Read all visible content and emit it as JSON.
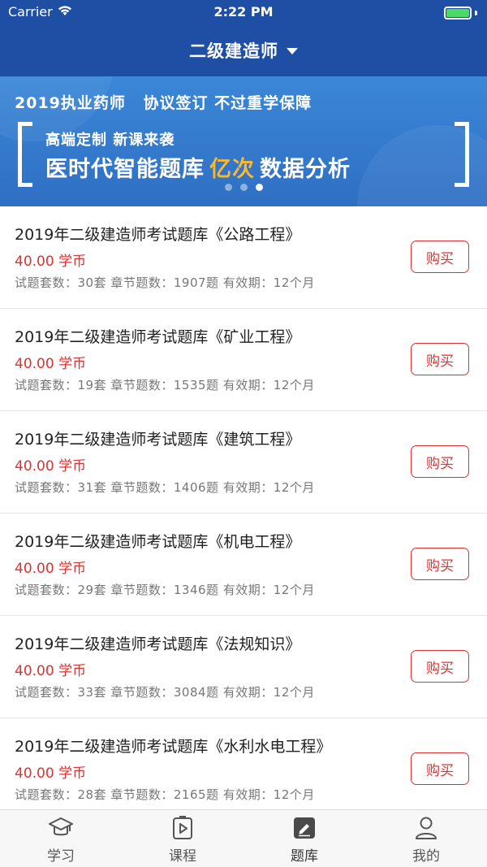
{
  "status_bar": {
    "carrier": "Carrier",
    "time": "2:22 PM"
  },
  "header": {
    "title": "二级建造师"
  },
  "banner": {
    "line1_a": "2019执业药师",
    "line1_b": "协议签订 不过重学保障",
    "line2": "高端定制 新课来袭",
    "line3_a": "医时代智能题库",
    "line3_highlight": "亿次",
    "line3_b": "数据分析",
    "dots_count": 3,
    "active_dot": 2
  },
  "products": [
    {
      "title": "2019年二级建造师考试题库《公路工程》",
      "price": "40.00 学币",
      "meta": "试题套数：30套   章节题数：1907题   有效期：12个月",
      "buy_label": "购买"
    },
    {
      "title": "2019年二级建造师考试题库《矿业工程》",
      "price": "40.00 学币",
      "meta": "试题套数：19套   章节题数：1535题   有效期：12个月",
      "buy_label": "购买"
    },
    {
      "title": "2019年二级建造师考试题库《建筑工程》",
      "price": "40.00 学币",
      "meta": "试题套数：31套   章节题数：1406题   有效期：12个月",
      "buy_label": "购买"
    },
    {
      "title": "2019年二级建造师考试题库《机电工程》",
      "price": "40.00 学币",
      "meta": "试题套数：29套   章节题数：1346题   有效期：12个月",
      "buy_label": "购买"
    },
    {
      "title": "2019年二级建造师考试题库《法规知识》",
      "price": "40.00 学币",
      "meta": "试题套数：33套   章节题数：3084题   有效期：12个月",
      "buy_label": "购买"
    },
    {
      "title": "2019年二级建造师考试题库《水利水电工程》",
      "price": "40.00 学币",
      "meta": "试题套数：28套   章节题数：2165题   有效期：12个月",
      "buy_label": "购买"
    }
  ],
  "tabbar": {
    "tabs": [
      {
        "label": "学习",
        "icon": "graduation-cap-icon"
      },
      {
        "label": "课程",
        "icon": "play-video-icon"
      },
      {
        "label": "题库",
        "icon": "edit-note-icon",
        "active": true
      },
      {
        "label": "我的",
        "icon": "user-profile-icon"
      }
    ]
  },
  "colors": {
    "header_bg": "#1f4fa5",
    "accent_red": "#e0302f",
    "highlight_orange": "#f7b731"
  }
}
